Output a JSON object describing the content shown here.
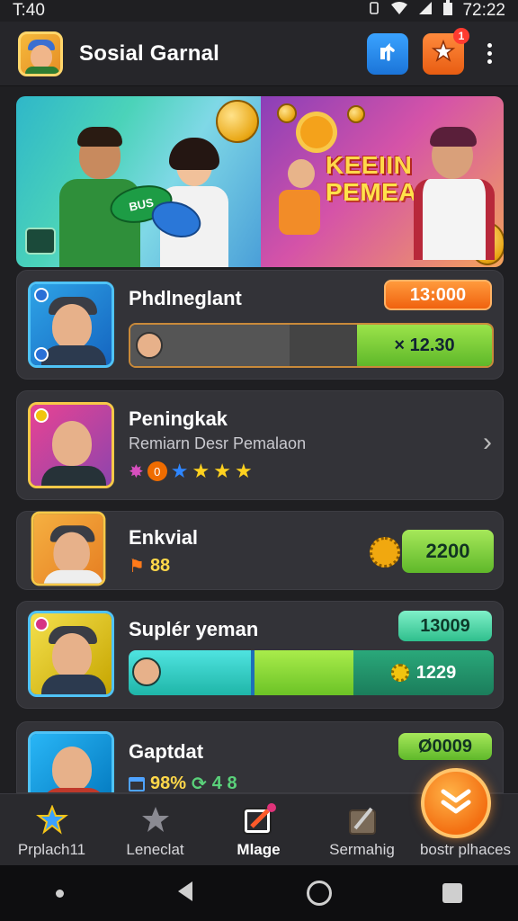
{
  "status_bar": {
    "time": "T:40",
    "clock": "72:22"
  },
  "header": {
    "title": "Sosial Garnal"
  },
  "banner": {
    "line1": "KEEIIN",
    "line2": "PEMEAS",
    "ball_text": "BUS"
  },
  "cards": [
    {
      "title": "Phdlneglant",
      "pill": "13:000",
      "bar_value": "× 12.30",
      "bar_fill": 0.44
    },
    {
      "title": "Peningkak",
      "subtitle": "Remiarn Desr Pemalaon",
      "stat": "0",
      "stars": 4
    },
    {
      "title": "Enkvial",
      "stat": "88",
      "pill": "2200"
    },
    {
      "title": "Suplér yeman",
      "pill": "13009",
      "bar_value": "1229"
    },
    {
      "title": "Gaptdat",
      "pill": "Ø0009",
      "stat_pct": "98%",
      "stat_b": "4 8"
    }
  ],
  "bottom_nav": [
    {
      "label": "Prplach11"
    },
    {
      "label": "Leneclat"
    },
    {
      "label": "Mlage"
    },
    {
      "label": "Sermahig"
    },
    {
      "label": "bostr plhaces"
    }
  ],
  "colors": {
    "accent_orange": "#f36f12",
    "accent_green": "#7ed321",
    "accent_blue": "#1b74d8"
  }
}
